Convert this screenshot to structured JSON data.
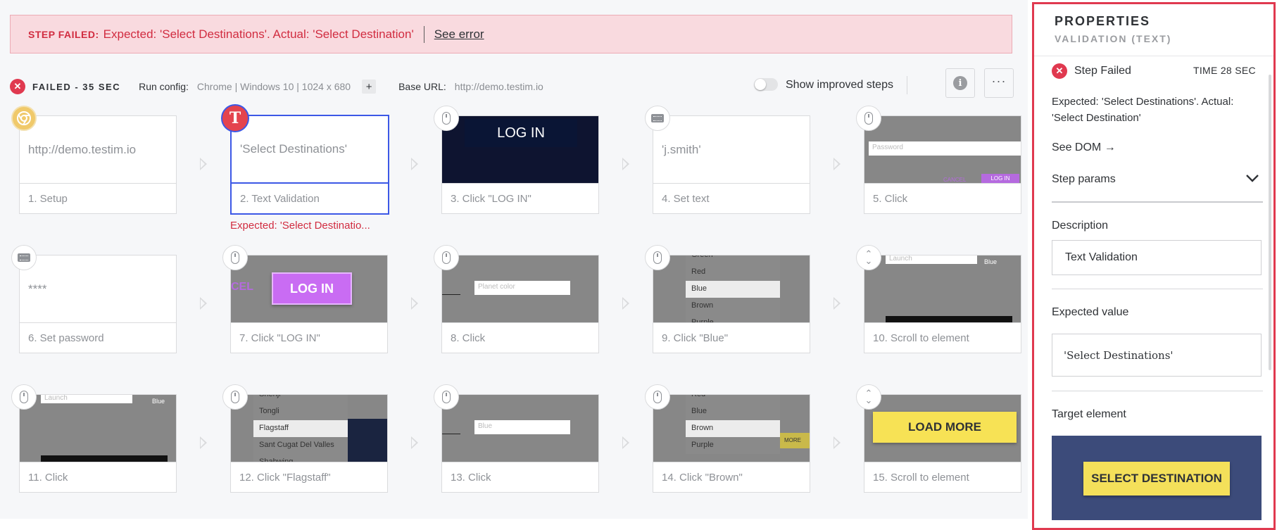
{
  "banner": {
    "lead": "STEP FAILED:",
    "message": "Expected: 'Select Destinations'. Actual: 'Select Destination'",
    "link": "See error"
  },
  "status": {
    "result": "FAILED - 35 SEC",
    "run_config_label": "Run config:",
    "run_config_value": "Chrome | Windows 10 | 1024 x 680",
    "plus": "+",
    "base_url_label": "Base URL:",
    "base_url_value": "http://demo.testim.io",
    "toggle_label": "Show improved steps",
    "more": "···"
  },
  "steps": [
    {
      "label": "1. Setup",
      "text": "http://demo.testim.io"
    },
    {
      "label": "2. Text Validation",
      "text": "'Select Destinations'",
      "error": "Expected: 'Select Destinatio..."
    },
    {
      "label": "3. Click \"LOG IN\"",
      "thumb_text": "LOG IN"
    },
    {
      "label": "4. Set text",
      "text": "'j.smith'"
    },
    {
      "label": "5. Click",
      "thumb_text": "Password",
      "thumb_buttons": [
        "CANCEL",
        "LOG IN"
      ]
    },
    {
      "label": "6. Set password",
      "text": "****"
    },
    {
      "label": "7. Click \"LOG IN\"",
      "thumb_text": "LOG IN",
      "thumb_left": "CEL"
    },
    {
      "label": "8. Click",
      "thumb_text": "Planet color"
    },
    {
      "label": "9. Click \"Blue\"",
      "options": [
        "Green",
        "Red",
        "Blue",
        "Brown",
        "Purple"
      ]
    },
    {
      "label": "10. Scroll to element",
      "thumb_text": "Launch",
      "thumb_right": "Blue"
    },
    {
      "label": "11. Click",
      "thumb_text": "Launch",
      "thumb_right": "Blue"
    },
    {
      "label": "12. Click \"Flagstaff\"",
      "options": [
        "Shenji",
        "Tongli",
        "Flagstaff",
        "Sant Cugat Del Valles",
        "Shabwing"
      ]
    },
    {
      "label": "13. Click",
      "thumb_text": "Blue"
    },
    {
      "label": "14. Click \"Brown\"",
      "options": [
        "Red",
        "Blue",
        "Brown",
        "Purple"
      ],
      "thumb_right": "MORE"
    },
    {
      "label": "15. Scroll to element",
      "thumb_text": "LOAD MORE"
    }
  ],
  "icons": {
    "setup": "chrome-icon",
    "validation": "T",
    "click": "mouse-icon",
    "text": "keyboard-icon",
    "scroll": "scroll-icon"
  },
  "panel": {
    "title": "PROPERTIES",
    "subtitle": "VALIDATION (TEXT)",
    "status": "Step Failed",
    "time": "TIME 28 SEC",
    "message": "Expected: 'Select Destinations'. Actual: 'Select Destination'",
    "see_dom": "See DOM →",
    "step_params": "Step params",
    "description_label": "Description",
    "description_value": "Text Validation",
    "expected_label": "Expected value",
    "expected_value": "'Select Destinations'",
    "target_label": "Target element",
    "target_button": "SELECT DESTINATION"
  },
  "colors": {
    "error": "#e0394f",
    "selection": "#3c58e6",
    "banner_bg": "#f9dadf"
  }
}
